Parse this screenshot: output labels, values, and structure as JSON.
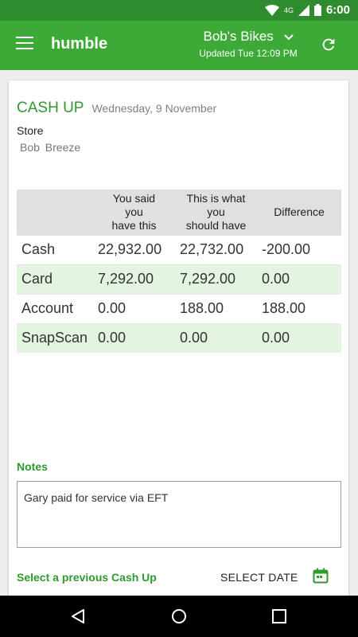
{
  "status_bar": {
    "network": "4G",
    "time": "6:00"
  },
  "app_bar": {
    "title": "humble",
    "store_name": "Bob's Bikes",
    "updated": "Updated Tue 12:09 PM"
  },
  "cashup": {
    "title": "CASH UP",
    "date": "Wednesday, 9 November",
    "store_label": "Store",
    "store_value": "Bob  Breeze"
  },
  "table": {
    "headers": [
      "",
      "You said\nyou\nhave this",
      "This is what\nyou\nshould have",
      "Difference"
    ],
    "rows": [
      [
        "Cash",
        "22,932.00",
        "22,732.00",
        "-200.00"
      ],
      [
        "Card",
        "7,292.00",
        "7,292.00",
        "0.00"
      ],
      [
        "Account",
        "0.00",
        "188.00",
        "188.00"
      ],
      [
        "SnapScan",
        "0.00",
        "0.00",
        "0.00"
      ]
    ]
  },
  "notes": {
    "label": "Notes",
    "value": "Gary paid for service via EFT"
  },
  "footer": {
    "previous_link": "Select a previous Cash Up",
    "select_date": "SELECT DATE"
  },
  "colors": {
    "status_bar": "#2e8b2e",
    "app_bar": "#3daa37",
    "accent_text": "#2f9a2f",
    "alt_row": "#e3f4e1"
  },
  "icons": {
    "menu": "hamburger-icon",
    "dropdown": "chevron-down-icon",
    "refresh": "refresh-icon",
    "calendar": "calendar-icon",
    "wifi": "wifi-icon",
    "signal": "signal-icon",
    "battery": "battery-icon",
    "back": "back-icon",
    "home": "home-icon",
    "recents": "recents-icon"
  }
}
